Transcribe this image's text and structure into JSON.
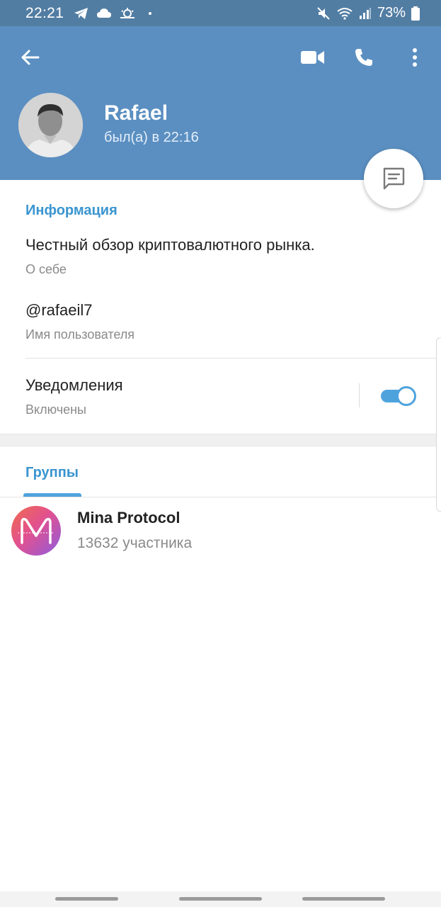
{
  "status_bar": {
    "time": "22:21",
    "battery": "73%",
    "icons": [
      "telegram-icon",
      "cloud-icon",
      "weather-icon",
      "mute-icon",
      "wifi-icon",
      "signal-icon",
      "battery-icon"
    ]
  },
  "header": {
    "name": "Rafael",
    "last_seen": "был(а) в 22:16",
    "color": "#5b8fc1"
  },
  "info": {
    "section_title": "Информация",
    "bio": "Честный обзор криптовалютного рынка.",
    "bio_label": "О себе",
    "username": "@rafaeil7",
    "username_label": "Имя пользователя",
    "notifications": "Уведомления",
    "notifications_state": "Включены",
    "notifications_on": true
  },
  "tabs": {
    "groups": "Группы"
  },
  "groups": [
    {
      "name": "Mina Protocol",
      "members": "13632 участника"
    }
  ],
  "accent_color": "#3a95d0"
}
